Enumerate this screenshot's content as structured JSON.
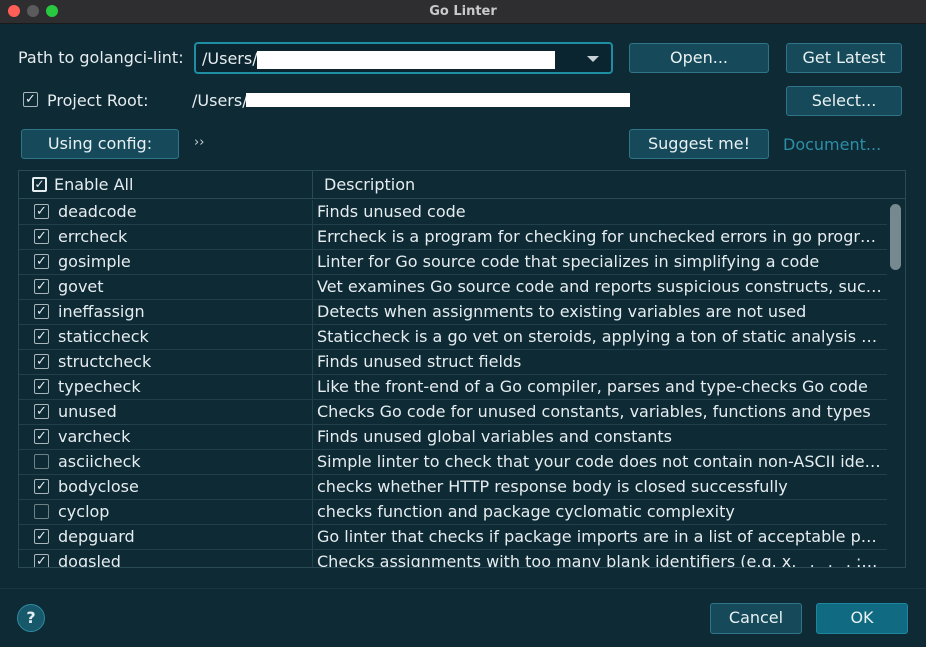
{
  "window": {
    "title": "Go Linter"
  },
  "path_row": {
    "label": "Path to golangci-lint:",
    "value": "/Users/",
    "open_button": "Open...",
    "get_latest_button": "Get Latest"
  },
  "project_root": {
    "label": "Project Root:",
    "checked": true,
    "path": "/Users/",
    "select_button": "Select..."
  },
  "config_row": {
    "using_config_button": "Using config:",
    "config_value": "››",
    "suggest_button": "Suggest me!",
    "document_link": "Document..."
  },
  "table": {
    "header": {
      "enable_all": "Enable All",
      "description": "Description"
    },
    "rows": [
      {
        "name": "deadcode",
        "checked": true,
        "description": "Finds unused code"
      },
      {
        "name": "errcheck",
        "checked": true,
        "description": "Errcheck is a program for checking for unchecked errors in go progra..."
      },
      {
        "name": "gosimple",
        "checked": true,
        "description": "Linter for Go source code that specializes in simplifying a code"
      },
      {
        "name": "govet",
        "checked": true,
        "description": "Vet examines Go source code and reports suspicious constructs, such..."
      },
      {
        "name": "ineffassign",
        "checked": true,
        "description": "Detects when assignments to existing variables are not used"
      },
      {
        "name": "staticcheck",
        "checked": true,
        "description": "Staticcheck is a go vet on steroids, applying a ton of static analysis che..."
      },
      {
        "name": "structcheck",
        "checked": true,
        "description": "Finds unused struct fields"
      },
      {
        "name": "typecheck",
        "checked": true,
        "description": "Like the front-end of a Go compiler, parses and type-checks Go code"
      },
      {
        "name": "unused",
        "checked": true,
        "description": "Checks Go code for unused constants, variables, functions and types"
      },
      {
        "name": "varcheck",
        "checked": true,
        "description": "Finds unused global variables and constants"
      },
      {
        "name": "asciicheck",
        "checked": false,
        "description": "Simple linter to check that your code does not contain non-ASCII iden..."
      },
      {
        "name": "bodyclose",
        "checked": true,
        "description": "checks whether HTTP response body is closed successfully"
      },
      {
        "name": "cyclop",
        "checked": false,
        "description": "checks function and package cyclomatic complexity"
      },
      {
        "name": "depguard",
        "checked": true,
        "description": "Go linter that checks if package imports are in a list of acceptable pack..."
      },
      {
        "name": "dogsled",
        "checked": true,
        "description": "Checks assignments with too many blank identifiers (e.g. x, _, _, _, := f())"
      }
    ]
  },
  "footer": {
    "help": "?",
    "cancel_button": "Cancel",
    "ok_button": "OK"
  },
  "icons": {
    "help": "help-icon",
    "dropdown": "chevron-down-icon",
    "check": "checkmark-icon"
  },
  "colors": {
    "background": "#0e2a35",
    "button": "#164a5a",
    "primary_button": "#0f6a82",
    "focus_border": "#1f8ea3",
    "link": "#2d8ea7"
  }
}
